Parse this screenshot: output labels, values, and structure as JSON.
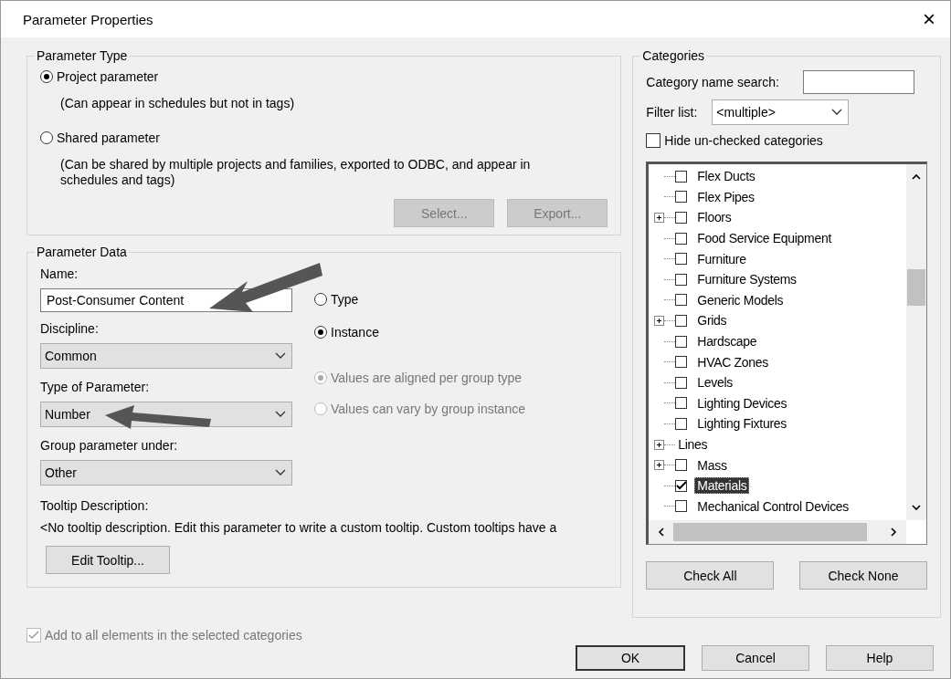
{
  "window": {
    "title": "Parameter Properties",
    "close": "×"
  },
  "parameter_type": {
    "legend": "Parameter Type",
    "options": [
      {
        "label": "Project parameter",
        "note": "(Can appear in schedules but not in tags)",
        "selected": true
      },
      {
        "label": "Shared parameter",
        "note": "(Can be shared by multiple projects and families, exported to ODBC, and appear in schedules and tags)",
        "selected": false
      }
    ],
    "buttons": [
      {
        "label": "Select...",
        "disabled": true
      },
      {
        "label": "Export...",
        "disabled": true
      }
    ]
  },
  "parameter_data": {
    "legend": "Parameter Data",
    "name_label": "Name:",
    "name_value": "Post-Consumer Content",
    "scope": [
      {
        "label": "Type",
        "selected": false
      },
      {
        "label": "Instance",
        "selected": true
      }
    ],
    "discipline_label": "Discipline:",
    "discipline": "Common",
    "type_label": "Type of Parameter:",
    "type": "Number",
    "group_options": [
      {
        "label": "Values are aligned per group type",
        "selected": true,
        "disabled": true
      },
      {
        "label": "Values can vary by group instance",
        "selected": false,
        "disabled": true
      }
    ],
    "group_label": "Group parameter under:",
    "group": "Other",
    "tooltip_label": "Tooltip Description:",
    "tooltip_text": "<No tooltip description. Edit this parameter to write a custom tooltip. Custom tooltips have a",
    "edit_tooltip": "Edit Tooltip..."
  },
  "categories": {
    "legend": "Categories",
    "search_label": "Category name search:",
    "filter_label": "Filter list:",
    "filter_value": "<multiple>",
    "hide_unchecked": {
      "label": "Hide un-checked categories",
      "checked": false
    },
    "items": [
      {
        "kind": "item",
        "label": "Flex Ducts",
        "checked": false,
        "expandable": false,
        "selected": false
      },
      {
        "kind": "item",
        "label": "Flex Pipes",
        "checked": false,
        "expandable": false,
        "selected": false
      },
      {
        "kind": "item",
        "label": "Floors",
        "checked": false,
        "expandable": true,
        "selected": false
      },
      {
        "kind": "item",
        "label": "Food Service Equipment",
        "checked": false,
        "expandable": false,
        "selected": false
      },
      {
        "kind": "item",
        "label": "Furniture",
        "checked": false,
        "expandable": false,
        "selected": false
      },
      {
        "kind": "item",
        "label": "Furniture Systems",
        "checked": false,
        "expandable": false,
        "selected": false
      },
      {
        "kind": "item",
        "label": "Generic Models",
        "checked": false,
        "expandable": false,
        "selected": false
      },
      {
        "kind": "item",
        "label": "Grids",
        "checked": false,
        "expandable": true,
        "selected": false
      },
      {
        "kind": "item",
        "label": "Hardscape",
        "checked": false,
        "expandable": false,
        "selected": false
      },
      {
        "kind": "item",
        "label": "HVAC Zones",
        "checked": false,
        "expandable": false,
        "selected": false
      },
      {
        "kind": "item",
        "label": "Levels",
        "checked": false,
        "expandable": false,
        "selected": false
      },
      {
        "kind": "item",
        "label": "Lighting Devices",
        "checked": false,
        "expandable": false,
        "selected": false
      },
      {
        "kind": "item",
        "label": "Lighting Fixtures",
        "checked": false,
        "expandable": false,
        "selected": false
      },
      {
        "kind": "group",
        "label": "Lines",
        "expandable": true,
        "selected": false
      },
      {
        "kind": "item",
        "label": "Mass",
        "checked": false,
        "expandable": true,
        "selected": false
      },
      {
        "kind": "item",
        "label": "Materials",
        "checked": true,
        "expandable": false,
        "selected": true
      },
      {
        "kind": "item",
        "label": "Mechanical Control Devices",
        "checked": false,
        "expandable": false,
        "selected": false
      }
    ],
    "check_all": "Check All",
    "check_none": "Check None"
  },
  "add_to_all": {
    "label": "Add to all elements in the selected categories",
    "checked": true,
    "disabled": true
  },
  "buttons": [
    {
      "label": "OK",
      "default": true
    },
    {
      "label": "Cancel",
      "default": false
    },
    {
      "label": "Help",
      "default": false
    }
  ]
}
